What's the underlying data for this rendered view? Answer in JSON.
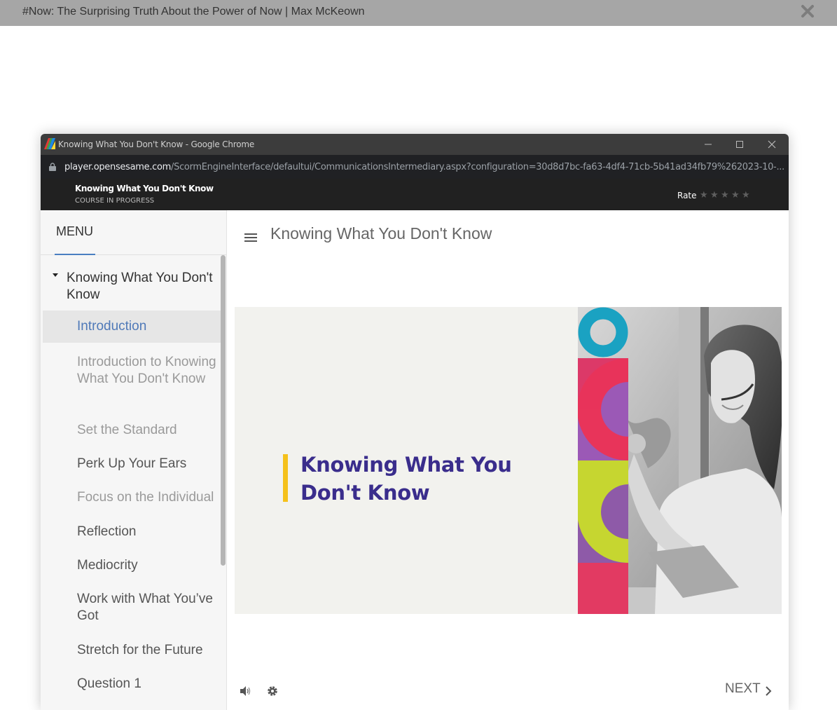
{
  "modal": {
    "title": "#Now: The Surprising Truth About the Power of Now | Max McKeown",
    "close_icon": "close-icon"
  },
  "browser": {
    "window_title": "Knowing What You Don't Know - Google Chrome",
    "url_host": "player.opensesame.com",
    "url_path": "/ScormEngineInterface/defaultui/CommunicationsIntermediary.aspx?configuration=30d8d7bc-fa63-4df4-71cb-5b41ad34fb79%262023-10-..."
  },
  "course_header": {
    "title": "Knowing What You Don't Know",
    "status": "COURSE IN PROGRESS",
    "rate_label": "Rate",
    "stars": [
      "★",
      "★",
      "★",
      "★",
      "★"
    ]
  },
  "menu": {
    "heading": "MENU",
    "section_title": "Knowing What You Don't Know",
    "items": [
      {
        "label": "Introduction"
      },
      {
        "label": "Introduction to Knowing What You Don't Know"
      },
      {
        "label": "Set the Standard"
      },
      {
        "label": "Perk Up Your Ears"
      },
      {
        "label": "Focus on the Individual"
      },
      {
        "label": "Reflection"
      },
      {
        "label": "Mediocrity"
      },
      {
        "label": "Work with What You’ve Got"
      },
      {
        "label": "Stretch for the Future"
      },
      {
        "label": "Question 1"
      }
    ]
  },
  "content": {
    "page_title": "Knowing What You Don't Know",
    "slide_title": "Knowing What You Don't Know",
    "next_label": "NEXT"
  },
  "colors": {
    "accent_blue": "#4f79b8",
    "slide_title": "#3a2d8c",
    "slide_bar": "#f5c11b"
  }
}
